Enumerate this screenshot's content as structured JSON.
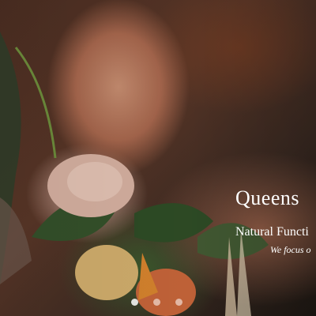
{
  "hero": {
    "image": "woman-with-flowers-photo",
    "title": "Queens",
    "subtitle": "Natural Functi",
    "tagline": "We focus o"
  },
  "carousel": {
    "slide_count": 3,
    "active_index": 0
  }
}
